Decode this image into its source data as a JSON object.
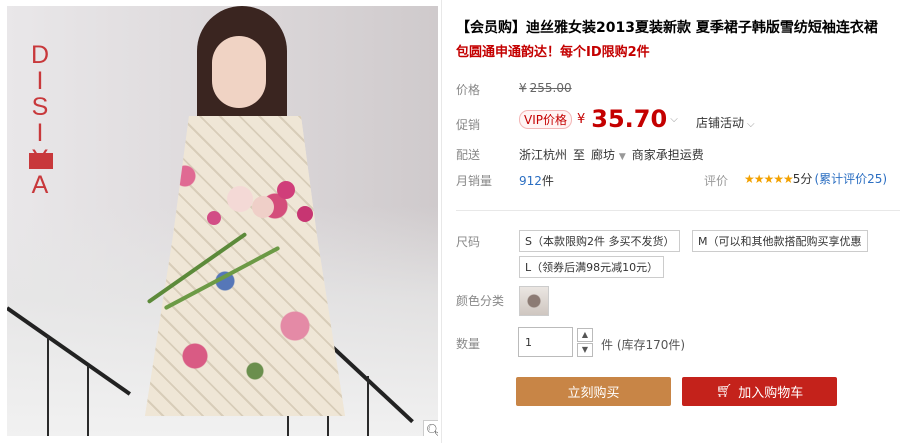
{
  "product": {
    "title": "【会员购】迪丝雅女装2013夏装新款 夏季裙子韩版雪纺短袖连衣裙",
    "subtitle": "包圆通申通韵达！每个ID限购2件",
    "brand_logo_text": "DISIYA"
  },
  "price": {
    "label": "价格",
    "currency": "¥",
    "original": "255.00"
  },
  "promo": {
    "label": "促销",
    "vip_badge": "VIP价格",
    "currency": "¥",
    "price": "35.70",
    "store_activity": "店铺活动"
  },
  "shipping": {
    "label": "配送",
    "from": "浙江杭州",
    "to_word": "至",
    "destination": "廊坊",
    "fee_note": "商家承担运费"
  },
  "sales": {
    "label": "月销量",
    "count": "912",
    "unit": "件",
    "rating_label": "评价",
    "stars": "★★★★★",
    "score": "5分",
    "total_link": "(累计评价25)"
  },
  "size": {
    "label": "尺码",
    "options": [
      "S（本款限购2件 多买不发货）",
      "M（可以和其他款搭配购买享优惠",
      "L（领券后满98元减10元）"
    ]
  },
  "color": {
    "label": "颜色分类"
  },
  "quantity": {
    "label": "数量",
    "value": "1",
    "unit": "件",
    "stock": "(库存170件)"
  },
  "actions": {
    "buy_now": "立刻购买",
    "add_to_cart": "加入购物车"
  },
  "icons": {
    "zoom": "magnifier-icon",
    "cart": "cart-icon",
    "up": "arrow-up-icon",
    "down": "arrow-down-icon"
  },
  "colors": {
    "accent_red": "#c40000",
    "buy_button": "#c88546",
    "cart_button": "#c4221b",
    "link_blue": "#2c6fc2",
    "star": "#f2a100"
  }
}
